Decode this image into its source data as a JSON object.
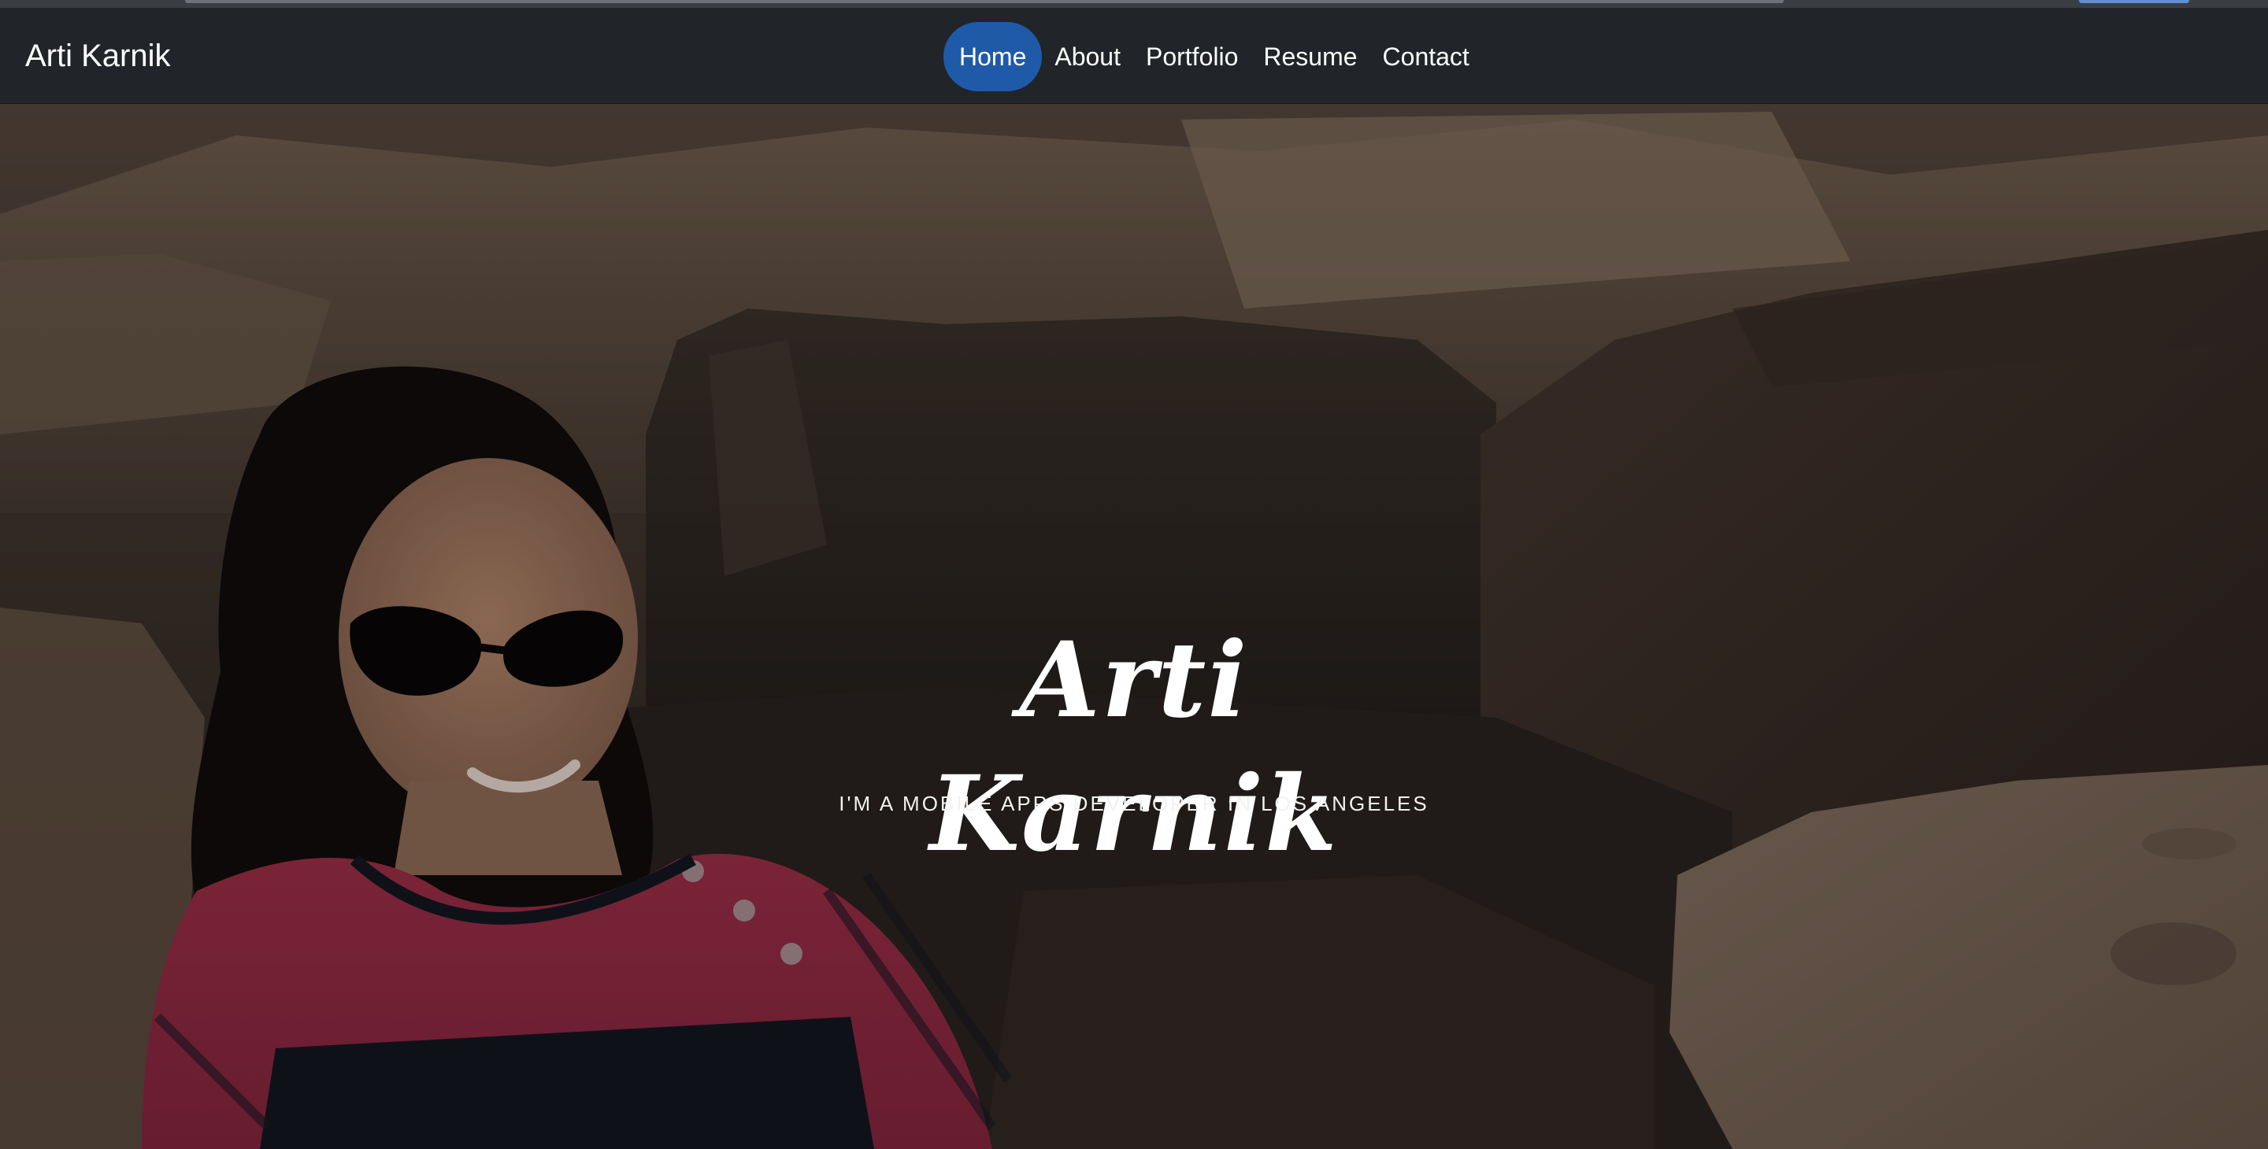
{
  "navbar": {
    "brand": "Arti Karnik",
    "links": [
      {
        "label": "Home",
        "active": true
      },
      {
        "label": "About",
        "active": false
      },
      {
        "label": "Portfolio",
        "active": false
      },
      {
        "label": "Resume",
        "active": false
      },
      {
        "label": "Contact",
        "active": false
      }
    ]
  },
  "hero": {
    "title": "Arti Karnik",
    "subtitle": "I'M A MOBILE APPS DEVELOPER IN LOS ANGELES"
  },
  "colors": {
    "navbar_bg": "#212529",
    "active_pill": "#1f5aa8",
    "text": "#ffffff"
  }
}
